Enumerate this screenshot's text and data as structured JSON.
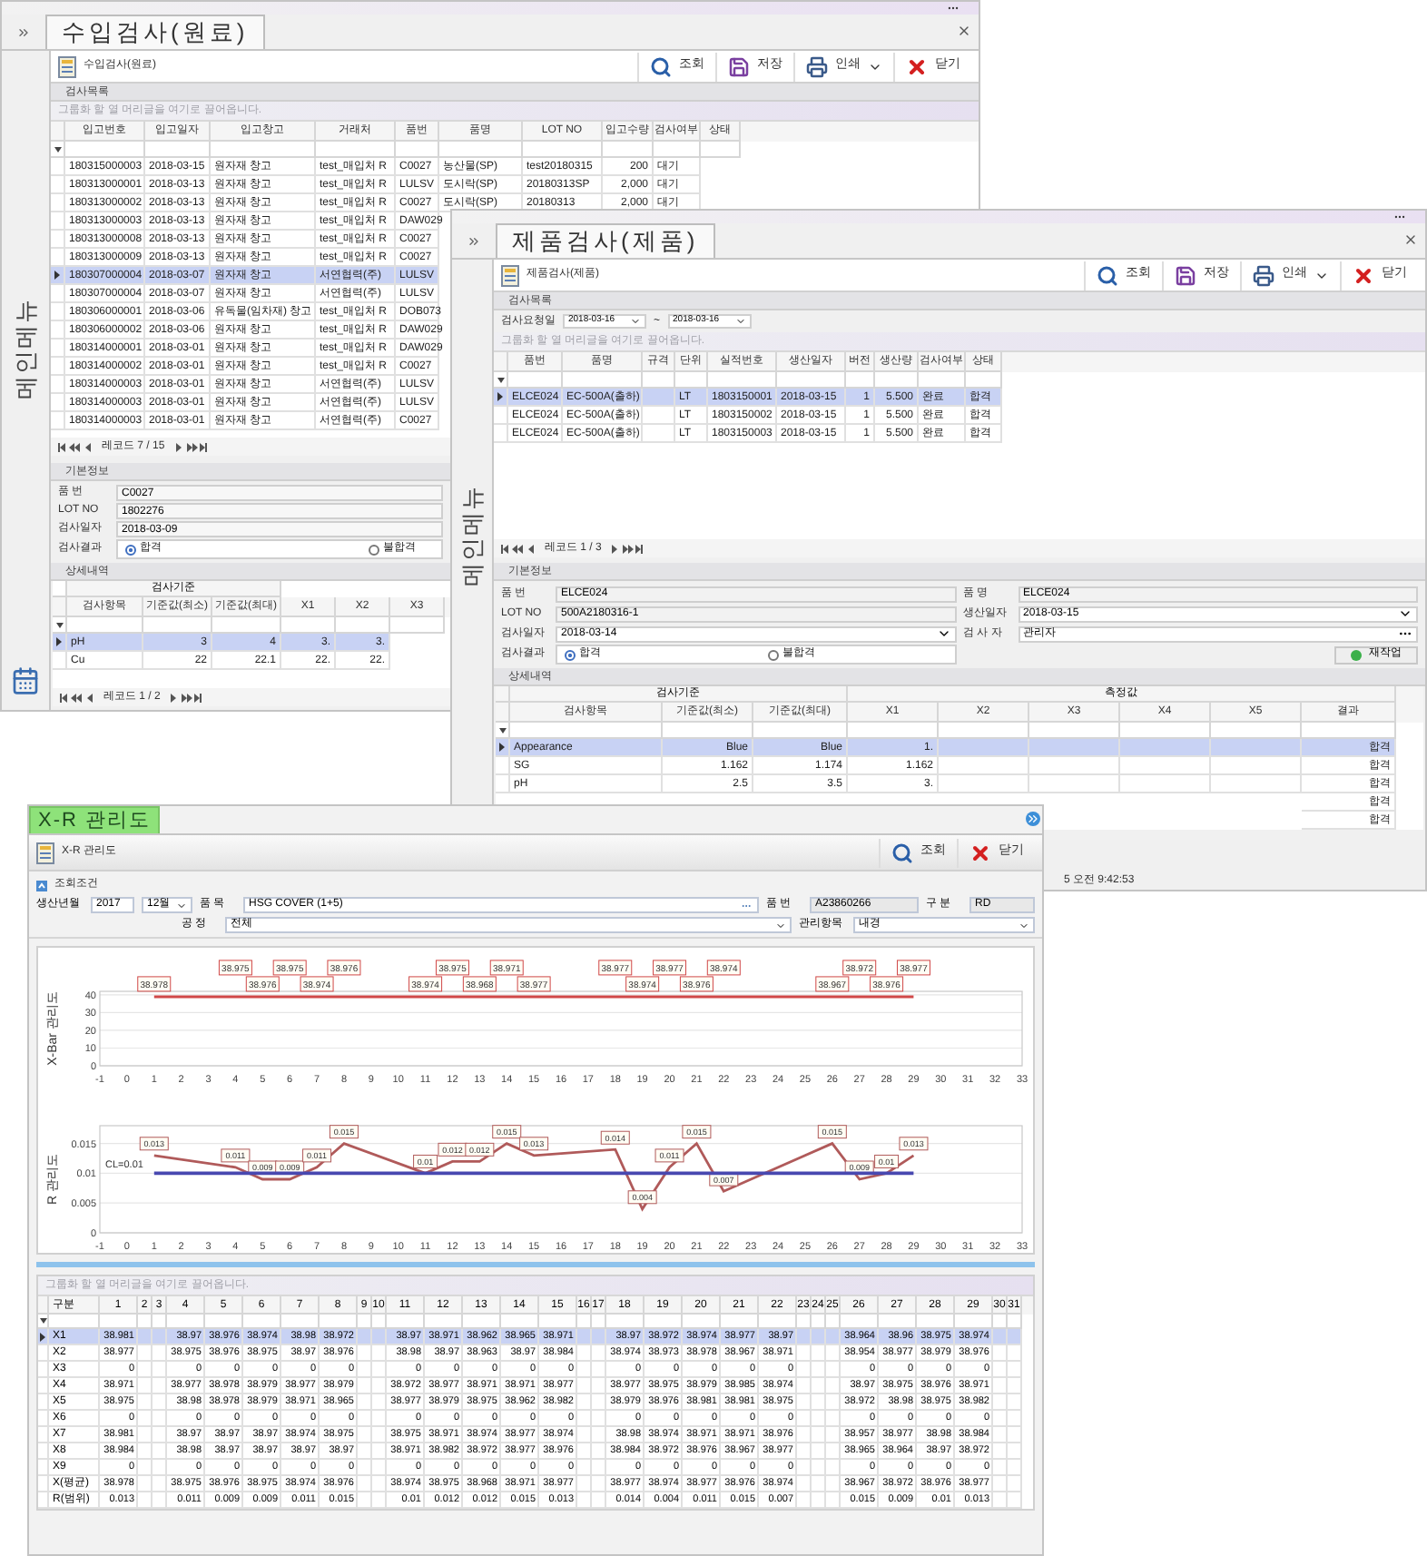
{
  "raw_inspection": {
    "side_menu": "메인메뉴",
    "tab": "수입검사(원료)",
    "form_title": "수입검사(원료)",
    "toolbar": [
      {
        "kind": "search",
        "label": "조회"
      },
      {
        "kind": "save",
        "label": "저장"
      },
      {
        "kind": "print",
        "label": "인쇄"
      },
      {
        "kind": "close",
        "label": "닫기"
      }
    ],
    "list_section": "검사목록",
    "group_hint": "그룹화 할 열 머리글을 여기로 끌어옵니다.",
    "columns": [
      "입고번호",
      "입고일자",
      "입고창고",
      "거래처",
      "품번",
      "품명",
      "LOT NO",
      "입고수량",
      "검사여부",
      "상태"
    ],
    "rows": [
      {
        "selected": false,
        "cells": [
          "180315000003",
          "2018-03-15",
          "원자재 창고",
          "test_매입처 R",
          "C0027",
          "농산물(SP)",
          "test20180315",
          "200",
          "대기"
        ]
      },
      {
        "selected": false,
        "cells": [
          "180313000001",
          "2018-03-13",
          "원자재 창고",
          "test_매입처 R",
          "LULSV",
          "도시락(SP)",
          "20180313SP",
          "2,000",
          "대기"
        ]
      },
      {
        "selected": false,
        "cells": [
          "180313000002",
          "2018-03-13",
          "원자재 창고",
          "test_매입처 R",
          "C0027",
          "도시락(SP)",
          "20180313",
          "2,000",
          "대기"
        ]
      },
      {
        "selected": false,
        "cells": [
          "180313000003",
          "2018-03-13",
          "원자재 창고",
          "test_매입처 R",
          "DAW029"
        ]
      },
      {
        "selected": false,
        "cells": [
          "180313000008",
          "2018-03-13",
          "원자재 창고",
          "test_매입처 R",
          "C0027"
        ]
      },
      {
        "selected": false,
        "cells": [
          "180313000009",
          "2018-03-13",
          "원자재 창고",
          "test_매입처 R",
          "C0027"
        ]
      },
      {
        "selected": true,
        "cells": [
          "180307000004",
          "2018-03-07",
          "원자재 창고",
          "서연협력(주)",
          "LULSV"
        ]
      },
      {
        "selected": false,
        "cells": [
          "180307000004",
          "2018-03-07",
          "원자재 창고",
          "서연협력(주)",
          "LULSV"
        ]
      },
      {
        "selected": false,
        "cells": [
          "180306000001",
          "2018-03-06",
          "유독물(임차재) 창고",
          "test_매입처 R",
          "DOB073"
        ]
      },
      {
        "selected": false,
        "cells": [
          "180306000002",
          "2018-03-06",
          "원자재 창고",
          "test_매입처 R",
          "DAW029"
        ]
      },
      {
        "selected": false,
        "cells": [
          "180314000001",
          "2018-03-01",
          "원자재 창고",
          "test_매입처 R",
          "DAW029"
        ]
      },
      {
        "selected": false,
        "cells": [
          "180314000002",
          "2018-03-01",
          "원자재 창고",
          "test_매입처 R",
          "C0027"
        ]
      },
      {
        "selected": false,
        "cells": [
          "180314000003",
          "2018-03-01",
          "원자재 창고",
          "서연협력(주)",
          "LULSV"
        ]
      },
      {
        "selected": false,
        "cells": [
          "180314000003",
          "2018-03-01",
          "원자재 창고",
          "서연협력(주)",
          "LULSV"
        ]
      },
      {
        "selected": false,
        "cells": [
          "180314000003",
          "2018-03-01",
          "원자재 창고",
          "서연협력(주)",
          "C0027"
        ]
      }
    ],
    "record_nav": "레코드 7 / 15",
    "basic_section": "기본정보",
    "fields": [
      {
        "label": "품 번",
        "value": "C0027"
      },
      {
        "label": "LOT NO",
        "value": "1802276"
      },
      {
        "label": "검사일자",
        "value": "2018-03-09"
      }
    ],
    "result_label": "검사결과",
    "result_options": [
      {
        "label": "합격",
        "selected": true
      },
      {
        "label": "불합격",
        "selected": false
      }
    ],
    "detail_section": "상세내역",
    "detail_group": "검사기준",
    "detail_columns": [
      "검사항목",
      "기준값(최소)",
      "기준값(최대)",
      "X1",
      "X2",
      "X3"
    ],
    "detail_rows": [
      {
        "selected": true,
        "cells": [
          "pH",
          "3",
          "4",
          "3.",
          "3."
        ]
      },
      {
        "selected": false,
        "cells": [
          "Cu",
          "22",
          "22.1",
          "22.",
          "22."
        ]
      }
    ],
    "detail_nav": "레코드 1 / 2"
  },
  "product_inspection": {
    "side_menu": "메인메뉴",
    "tab": "제품검사(제품)",
    "form_title": "제품검사(제품)",
    "toolbar": [
      {
        "kind": "search",
        "label": "조회"
      },
      {
        "kind": "save",
        "label": "저장"
      },
      {
        "kind": "print",
        "label": "인쇄"
      },
      {
        "kind": "close",
        "label": "닫기"
      }
    ],
    "list_section": "검사목록",
    "date_label": "검사요청일",
    "date_from": "2018-03-16",
    "date_sep": "~",
    "date_to": "2018-03-16",
    "group_hint": "그룹화 할 열 머리글을 여기로 끌어옵니다.",
    "columns": [
      "품번",
      "품명",
      "규격",
      "단위",
      "실적번호",
      "생산일자",
      "버전",
      "생산량",
      "검사여부",
      "상태"
    ],
    "rows": [
      {
        "selected": true,
        "cells": [
          "ELCE024",
          "EC-500A(출하)",
          null,
          "LT",
          "1803150001",
          "2018-03-15",
          "1",
          "5.500",
          "완료",
          "합격"
        ]
      },
      {
        "selected": false,
        "cells": [
          "ELCE024",
          "EC-500A(출하)",
          null,
          "LT",
          "1803150002",
          "2018-03-15",
          "1",
          "5.500",
          "완료",
          "합격"
        ]
      },
      {
        "selected": false,
        "cells": [
          "ELCE024",
          "EC-500A(출하)",
          null,
          "LT",
          "1803150003",
          "2018-03-15",
          "1",
          "5.500",
          "완료",
          "합격"
        ]
      }
    ],
    "record_nav": "레코드 1 / 3",
    "basic_section": "기본정보",
    "fields": [
      {
        "label": "품 번",
        "value": "ELCE024",
        "kind": "text"
      },
      {
        "label": "품 명",
        "value": "ELCE024",
        "kind": "text"
      },
      {
        "label": "LOT NO",
        "value": "500A2180316-1",
        "kind": "text"
      },
      {
        "label": "생산일자",
        "value": "2018-03-15",
        "kind": "date"
      },
      {
        "label": "검사일자",
        "value": "2018-03-14",
        "kind": "date"
      },
      {
        "label": "검 사 자",
        "value": "관리자",
        "kind": "lookup"
      }
    ],
    "result_label": "검사결과",
    "result_options": [
      {
        "label": "합격",
        "selected": true
      },
      {
        "label": "불합격",
        "selected": false
      }
    ],
    "rework_button": "재작업",
    "detail_section": "상세내역",
    "detail_groups": [
      "검사기준",
      "측정값"
    ],
    "detail_columns": [
      "검사항목",
      "기준값(최소)",
      "기준값(최대)",
      "X1",
      "X2",
      "X3",
      "X4",
      "X5",
      "결과"
    ],
    "detail_rows": [
      {
        "selected": true,
        "cells": [
          "Appearance",
          "Blue",
          "Blue",
          "1.",
          null,
          null,
          null,
          null,
          "합격"
        ]
      },
      {
        "selected": false,
        "cells": [
          "SG",
          "1.162",
          "1.174",
          "1.162",
          null,
          null,
          null,
          null,
          "합격"
        ]
      },
      {
        "selected": false,
        "cells": [
          "pH",
          "2.5",
          "3.5",
          "3.",
          null,
          null,
          null,
          null,
          "합격"
        ]
      },
      {
        "selected": false,
        "cells": [
          null,
          null,
          null,
          null,
          null,
          null,
          null,
          null,
          "합격"
        ]
      },
      {
        "selected": false,
        "cells": [
          null,
          null,
          null,
          null,
          null,
          null,
          null,
          null,
          "합격"
        ]
      }
    ],
    "status": "5 오전 9:42:53"
  },
  "xr_chart": {
    "tab": "X-R 관리도",
    "form_title": "X-R 관리도",
    "toolbar": [
      {
        "kind": "search",
        "label": "조회"
      },
      {
        "kind": "close",
        "label": "닫기"
      }
    ],
    "condition_section": "조회조건",
    "period_label": "생산년월",
    "year": "2017",
    "month": "12월",
    "item_label": "품 목",
    "item": "HSG COVER (1+5)",
    "part_label": "품 번",
    "part": "A23860266",
    "type_label": "구 분",
    "type": "RD",
    "process_label": "공 정",
    "process": "전체",
    "control_label": "관리항목",
    "control": "내경",
    "xbar_chart": {
      "chart_data": {
        "type": "line",
        "ylabel": "X-Bar 관리도",
        "x": [
          1,
          4,
          5,
          6,
          7,
          8,
          11,
          12,
          13,
          14,
          15,
          18,
          19,
          20,
          21,
          22,
          26,
          27,
          28,
          29
        ],
        "series": [
          {
            "color": "#d04848",
            "values": [
              38.978,
              38.975,
              38.976,
              38.975,
              38.974,
              38.976,
              38.974,
              38.975,
              38.968,
              38.971,
              38.977,
              38.977,
              38.974,
              38.977,
              38.976,
              38.974,
              38.967,
              38.972,
              38.976,
              38.977
            ]
          }
        ],
        "xlim": [
          -1,
          33
        ],
        "ylim": [
          0,
          42
        ],
        "xticks": [
          -1,
          0,
          1,
          2,
          3,
          4,
          5,
          6,
          7,
          8,
          9,
          10,
          11,
          12,
          13,
          14,
          15,
          16,
          17,
          18,
          19,
          20,
          21,
          22,
          23,
          24,
          25,
          26,
          27,
          28,
          29,
          30,
          31,
          32,
          33
        ],
        "yticks": [
          0,
          10,
          20,
          30,
          40
        ],
        "grid": true,
        "data_labels": true
      }
    },
    "r_chart": {
      "chart_data": {
        "type": "line",
        "ylabel": "R 관리도",
        "x": [
          1,
          4,
          5,
          6,
          7,
          8,
          11,
          12,
          13,
          14,
          15,
          18,
          19,
          20,
          21,
          22,
          26,
          27,
          28,
          29
        ],
        "series": [
          {
            "color": "#b05a5a",
            "values": [
              0.013,
              0.011,
              0.009,
              0.009,
              0.011,
              0.015,
              0.01,
              0.012,
              0.012,
              0.015,
              0.013,
              0.014,
              0.004,
              0.011,
              0.015,
              0.007,
              0.015,
              0.009,
              0.01,
              0.013
            ],
            "value_labels": [
              "0.013",
              "0.011",
              "0.009",
              "0.009",
              "0.011",
              "0.015",
              "0.01",
              "0.012",
              "0.012",
              "0.015",
              "0.013",
              "0.014",
              "0.004",
              "0.011",
              "0.015",
              "0.007",
              "0.015",
              "0.009",
              "0.01",
              "0.013"
            ]
          },
          {
            "name": "CL=0.01",
            "color": "#4848b0",
            "values": [
              0.01,
              0.01,
              0.01,
              0.01,
              0.01,
              0.01,
              0.01,
              0.01,
              0.01,
              0.01,
              0.01,
              0.01,
              0.01,
              0.01,
              0.01,
              0.01,
              0.01,
              0.01,
              0.01,
              0.01
            ]
          }
        ],
        "xlim": [
          -1,
          33
        ],
        "ylim": [
          0,
          0.018
        ],
        "xticks": [
          -1,
          0,
          1,
          2,
          3,
          4,
          5,
          6,
          7,
          8,
          9,
          10,
          11,
          12,
          13,
          14,
          15,
          16,
          17,
          18,
          19,
          20,
          21,
          22,
          23,
          24,
          25,
          26,
          27,
          28,
          29,
          30,
          31,
          32,
          33
        ],
        "yticks": [
          0,
          0.005,
          0.01,
          0.015
        ],
        "grid": true
      }
    },
    "group_hint": "그룹화 할 열 머리글을 여기로 끌어옵니다.",
    "table": {
      "columns": [
        "구분",
        "1",
        "2",
        "3",
        "4",
        "5",
        "6",
        "7",
        "8",
        "9",
        "10",
        "11",
        "12",
        "13",
        "14",
        "15",
        "16",
        "17",
        "18",
        "19",
        "20",
        "21",
        "22",
        "23",
        "24",
        "25",
        "26",
        "27",
        "28",
        "29",
        "30",
        "31"
      ],
      "rows": [
        {
          "selected": true,
          "cells": [
            "X1",
            "38.981",
            null,
            null,
            "38.97",
            "38.976",
            "38.974",
            "38.98",
            "38.972",
            null,
            null,
            "38.97",
            "38.971",
            "38.962",
            "38.965",
            "38.971",
            null,
            null,
            "38.97",
            "38.972",
            "38.974",
            "38.977",
            "38.97",
            null,
            null,
            null,
            "38.964",
            "38.96",
            "38.975",
            "38.974",
            null,
            null
          ]
        },
        {
          "selected": false,
          "cells": [
            "X2",
            "38.977",
            null,
            null,
            "38.975",
            "38.976",
            "38.975",
            "38.97",
            "38.976",
            null,
            null,
            "38.98",
            "38.97",
            "38.963",
            "38.97",
            "38.984",
            null,
            null,
            "38.974",
            "38.973",
            "38.978",
            "38.967",
            "38.971",
            null,
            null,
            null,
            "38.954",
            "38.977",
            "38.979",
            "38.976",
            null,
            null
          ]
        },
        {
          "selected": false,
          "cells": [
            "X3",
            "0",
            null,
            null,
            "0",
            "0",
            "0",
            "0",
            "0",
            null,
            null,
            "0",
            "0",
            "0",
            "0",
            "0",
            null,
            null,
            "0",
            "0",
            "0",
            "0",
            "0",
            null,
            null,
            null,
            "0",
            "0",
            "0",
            "0",
            null,
            null
          ]
        },
        {
          "selected": false,
          "cells": [
            "X4",
            "38.971",
            null,
            null,
            "38.977",
            "38.978",
            "38.979",
            "38.977",
            "38.979",
            null,
            null,
            "38.972",
            "38.977",
            "38.971",
            "38.971",
            "38.977",
            null,
            null,
            "38.977",
            "38.975",
            "38.979",
            "38.985",
            "38.974",
            null,
            null,
            null,
            "38.97",
            "38.975",
            "38.976",
            "38.971",
            null,
            null
          ]
        },
        {
          "selected": false,
          "cells": [
            "X5",
            "38.975",
            null,
            null,
            "38.98",
            "38.978",
            "38.979",
            "38.971",
            "38.965",
            null,
            null,
            "38.977",
            "38.979",
            "38.975",
            "38.962",
            "38.982",
            null,
            null,
            "38.979",
            "38.976",
            "38.981",
            "38.981",
            "38.975",
            null,
            null,
            null,
            "38.972",
            "38.98",
            "38.975",
            "38.982",
            null,
            null
          ]
        },
        {
          "selected": false,
          "cells": [
            "X6",
            "0",
            null,
            null,
            "0",
            "0",
            "0",
            "0",
            "0",
            null,
            null,
            "0",
            "0",
            "0",
            "0",
            "0",
            null,
            null,
            "0",
            "0",
            "0",
            "0",
            "0",
            null,
            null,
            null,
            "0",
            "0",
            "0",
            "0",
            null,
            null
          ]
        },
        {
          "selected": false,
          "cells": [
            "X7",
            "38.981",
            null,
            null,
            "38.97",
            "38.97",
            "38.97",
            "38.974",
            "38.975",
            null,
            null,
            "38.975",
            "38.971",
            "38.974",
            "38.977",
            "38.974",
            null,
            null,
            "38.98",
            "38.974",
            "38.971",
            "38.971",
            "38.976",
            null,
            null,
            null,
            "38.957",
            "38.977",
            "38.98",
            "38.984",
            null,
            null
          ]
        },
        {
          "selected": false,
          "cells": [
            "X8",
            "38.984",
            null,
            null,
            "38.98",
            "38.97",
            "38.97",
            "38.97",
            "38.97",
            null,
            null,
            "38.971",
            "38.982",
            "38.972",
            "38.977",
            "38.976",
            null,
            null,
            "38.984",
            "38.972",
            "38.976",
            "38.967",
            "38.977",
            null,
            null,
            null,
            "38.965",
            "38.964",
            "38.97",
            "38.972",
            null,
            null
          ]
        },
        {
          "selected": false,
          "cells": [
            "X9",
            "0",
            null,
            null,
            "0",
            "0",
            "0",
            "0",
            "0",
            null,
            null,
            "0",
            "0",
            "0",
            "0",
            "0",
            null,
            null,
            "0",
            "0",
            "0",
            "0",
            "0",
            null,
            null,
            null,
            "0",
            "0",
            "0",
            "0",
            null,
            null
          ]
        },
        {
          "selected": false,
          "cells": [
            "X(평균)",
            "38.978",
            null,
            null,
            "38.975",
            "38.976",
            "38.975",
            "38.974",
            "38.976",
            null,
            null,
            "38.974",
            "38.975",
            "38.968",
            "38.971",
            "38.977",
            null,
            null,
            "38.977",
            "38.974",
            "38.977",
            "38.976",
            "38.974",
            null,
            null,
            null,
            "38.967",
            "38.972",
            "38.976",
            "38.977",
            null,
            null
          ]
        },
        {
          "selected": false,
          "cells": [
            "R(범위)",
            "0.013",
            null,
            null,
            "0.011",
            "0.009",
            "0.009",
            "0.011",
            "0.015",
            null,
            null,
            "0.01",
            "0.012",
            "0.012",
            "0.015",
            "0.013",
            null,
            null,
            "0.014",
            "0.004",
            "0.011",
            "0.015",
            "0.007",
            null,
            null,
            null,
            "0.015",
            "0.009",
            "0.01",
            "0.013",
            null,
            null
          ]
        }
      ]
    }
  }
}
